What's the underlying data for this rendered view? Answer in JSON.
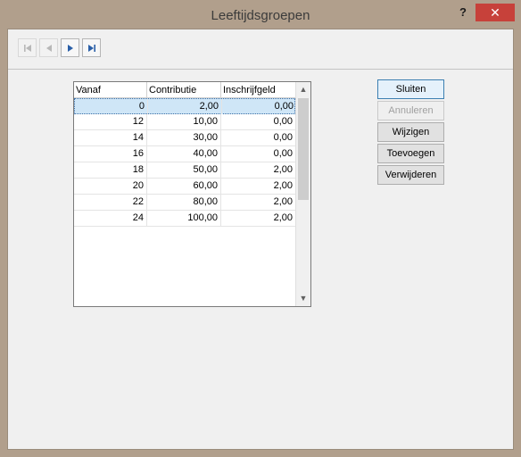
{
  "window": {
    "title": "Leeftijdsgroepen",
    "help_label": "?",
    "close_label": "✕"
  },
  "toolbar": {
    "icons": [
      "nav-first-icon",
      "nav-prev-icon",
      "nav-next-icon",
      "nav-last-icon"
    ]
  },
  "grid": {
    "columns": [
      "Vanaf",
      "Contributie",
      "Inschrijfgeld"
    ],
    "rows": [
      [
        "0",
        "2,00",
        "0,00"
      ],
      [
        "12",
        "10,00",
        "0,00"
      ],
      [
        "14",
        "30,00",
        "0,00"
      ],
      [
        "16",
        "40,00",
        "0,00"
      ],
      [
        "18",
        "50,00",
        "2,00"
      ],
      [
        "20",
        "60,00",
        "2,00"
      ],
      [
        "22",
        "80,00",
        "2,00"
      ],
      [
        "24",
        "100,00",
        "2,00"
      ]
    ]
  },
  "buttons": {
    "close": "Sluiten",
    "cancel": "Annuleren",
    "edit": "Wijzigen",
    "add": "Toevoegen",
    "delete": "Verwijderen"
  },
  "colors": {
    "selected_row": "#cfe6f7",
    "close_button": "#c7413a",
    "nav_arrow_active": "#2a5fa8"
  }
}
